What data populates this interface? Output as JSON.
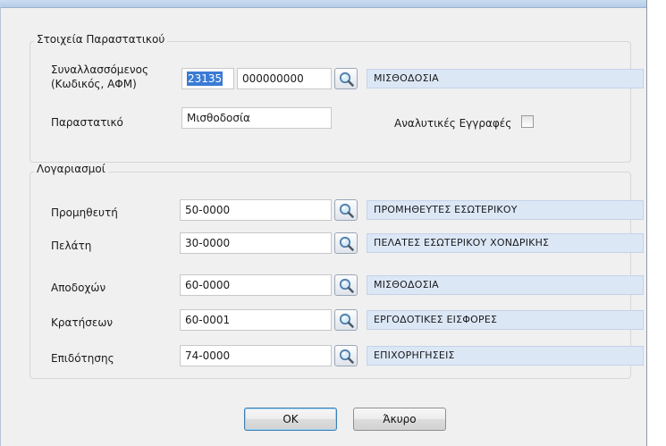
{
  "header": {
    "group_title": "Στοιχεία Παραστατικού",
    "party_label_line1": "Συναλλασσόμενος",
    "party_label_line2": "(Κωδικός, ΑΦΜ)",
    "party_code": "23135",
    "party_vat": "000000000",
    "party_name": "ΜΙΣΘΟΔΟΣΙΑ",
    "document_label": "Παραστατικό",
    "document_value": "Μισθοδοσία",
    "detailed_label": "Αναλυτικές Εγγραφές",
    "detailed_checked": false
  },
  "accounts": {
    "group_title": "Λογαριασμοί",
    "rows": [
      {
        "label": "Προμηθευτή",
        "code": "50-0000",
        "name": "ΠΡΟΜΗΘΕΥΤΕΣ ΕΣΩΤΕΡΙΚΟΥ"
      },
      {
        "label": "Πελάτη",
        "code": "30-0000",
        "name": "ΠΕΛΑΤΕΣ ΕΣΩΤΕΡΙΚΟΥ ΧΟΝΔΡΙΚΗΣ"
      },
      {
        "label": "Αποδοχών",
        "code": "60-0000",
        "name": "ΜΙΣΘΟΔΟΣΙΑ"
      },
      {
        "label": "Κρατήσεων",
        "code": "60-0001",
        "name": "ΕΡΓΟΔΟΤΙΚΕΣ ΕΙΣΦΟΡΕΣ"
      },
      {
        "label": "Επιδότησης",
        "code": "74-0000",
        "name": "ΕΠΙΧΟΡΗΓΗΣΕΙΣ"
      }
    ]
  },
  "buttons": {
    "ok_label": "OK",
    "cancel_label": "Άκυρο"
  },
  "icons": {
    "lookup": "search-icon"
  },
  "colors": {
    "readonly_bg": "#dce7f6",
    "selection": "#3a7bd5"
  }
}
